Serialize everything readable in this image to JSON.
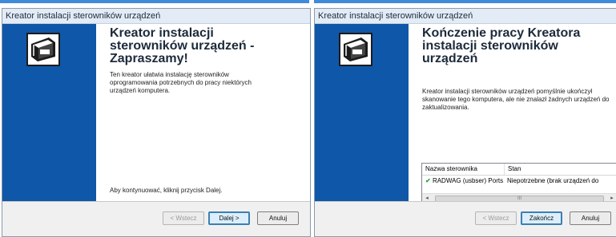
{
  "colors": {
    "banner": "#0f57a9",
    "titlebar": "#e3ecf6",
    "check": "#2fa32f",
    "focus_border": "#3c7fb1",
    "top_accent": "#3f8ad9"
  },
  "left_window": {
    "title": "Kreator instalacji sterowników urządzeń",
    "icon": "hardware-device-icon",
    "heading": "Kreator instalacji sterowników urządzeń - Zapraszamy!",
    "description": "Ten kreator ułatwia instalację sterowników oprogramowania potrzebnych do pracy niektórych urządzeń komputera.",
    "hint": "Aby kontynuować, kliknij przycisk Dalej.",
    "buttons": {
      "back": "< Wstecz",
      "next": "Dalej >",
      "cancel": "Anuluj"
    }
  },
  "right_window": {
    "title": "Kreator instalacji sterowników urządzeń",
    "icon": "hardware-device-icon",
    "heading": "Kończenie pracy Kreatora instalacji sterowników urządzeń",
    "description": "Kreator instalacji sterowników urządzeń pomyślnie ukończył skanowanie tego komputera, ale nie znalazł żadnych urządzeń do zaktualizowania.",
    "table": {
      "columns": [
        "Nazwa sterownika",
        "Stan"
      ],
      "rows": [
        {
          "name": "RADWAG (usbser) Ports...",
          "status": "Niepotrzebne (brak urządzeń do"
        }
      ]
    },
    "buttons": {
      "back": "< Wstecz",
      "finish": "Zakończ",
      "cancel": "Anuluj"
    }
  }
}
